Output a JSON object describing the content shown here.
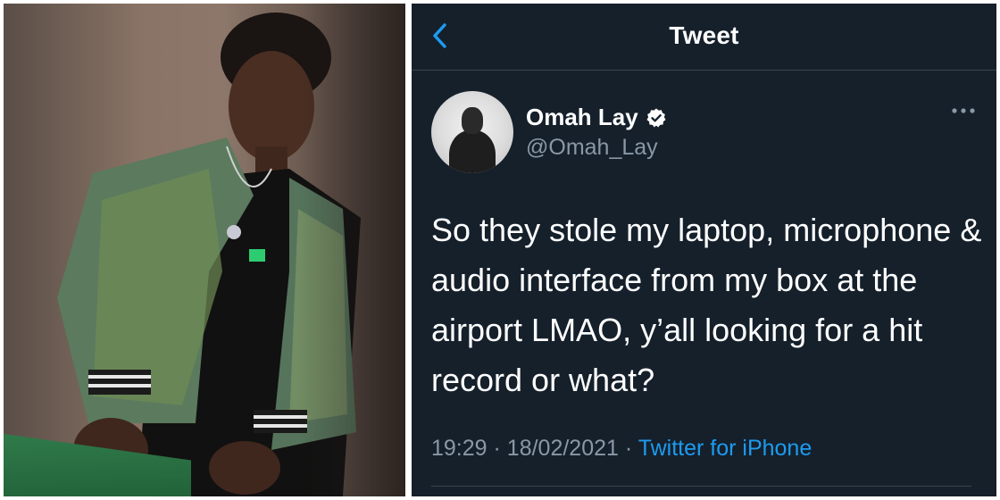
{
  "header": {
    "title": "Tweet"
  },
  "tweet": {
    "author": {
      "display_name": "Omah Lay",
      "handle": "@Omah_Lay",
      "verified": true
    },
    "text": "So they stole my laptop, microphone & audio interface from my box at the airport LMAO, y’all looking for a hit record or what?",
    "time": "19:29",
    "date": "18/02/2021",
    "separator": "·",
    "source": "Twitter for iPhone"
  },
  "icons": {
    "back": "chevron-left-icon",
    "verified": "verified-badge-icon",
    "more": "more-horizontal-icon"
  },
  "colors": {
    "background": "#15202b",
    "accent": "#1d9bf0",
    "secondary_text": "#8b98a5",
    "divider": "#38444d"
  }
}
